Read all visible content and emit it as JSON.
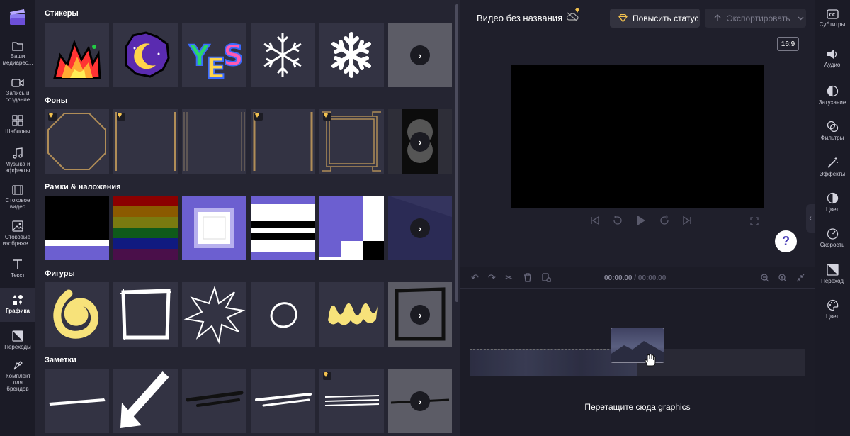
{
  "left_nav": {
    "items": [
      {
        "label": "Ваши медиарес...",
        "icon": "folder-icon"
      },
      {
        "label": "Запись и создание",
        "icon": "camera-icon"
      },
      {
        "label": "Шаблоны",
        "icon": "templates-icon"
      },
      {
        "label": "Музыка и эффекты",
        "icon": "music-icon"
      },
      {
        "label": "Стоковое видео",
        "icon": "film-icon"
      },
      {
        "label": "Стоковые изображе...",
        "icon": "image-icon"
      },
      {
        "label": "Текст",
        "icon": "text-icon"
      },
      {
        "label": "Графика",
        "icon": "shapes-icon",
        "active": true
      },
      {
        "label": "Переходы",
        "icon": "transition-icon"
      },
      {
        "label": "Комплект для брендов",
        "icon": "brand-kit-icon"
      }
    ]
  },
  "panel": {
    "sections": [
      {
        "title": "Стикеры"
      },
      {
        "title": "Фоны"
      },
      {
        "title": "Рамки & наложения"
      },
      {
        "title": "Фигуры"
      },
      {
        "title": "Заметки"
      }
    ],
    "more_glyph": "›"
  },
  "header": {
    "project_title": "Видео без названия",
    "upgrade_label": "Повысить статус",
    "export_label": "Экспортировать"
  },
  "preview": {
    "aspect_ratio": "16:9",
    "help_glyph": "?"
  },
  "timeline": {
    "current_time": "00:00.00",
    "separator": "/",
    "total_time": "00:00.00",
    "drop_hint": "Перетащите сюда graphics"
  },
  "right_nav": {
    "items": [
      {
        "label": "Субтитры",
        "icon": "captions-icon"
      },
      {
        "label": "Аудио",
        "icon": "speaker-icon"
      },
      {
        "label": "Затухание",
        "icon": "fade-icon"
      },
      {
        "label": "Фильтры",
        "icon": "filters-icon"
      },
      {
        "label": "Эффекты",
        "icon": "magic-wand-icon"
      },
      {
        "label": "Цвет",
        "icon": "color-icon"
      },
      {
        "label": "Скорость",
        "icon": "speed-icon"
      },
      {
        "label": "Переход",
        "icon": "transition-icon"
      },
      {
        "label": "Цвет",
        "icon": "palette-icon"
      }
    ]
  },
  "colors": {
    "accent": "#6c5fd0",
    "premium": "#f2c14e",
    "background": "#1f1f2c"
  }
}
